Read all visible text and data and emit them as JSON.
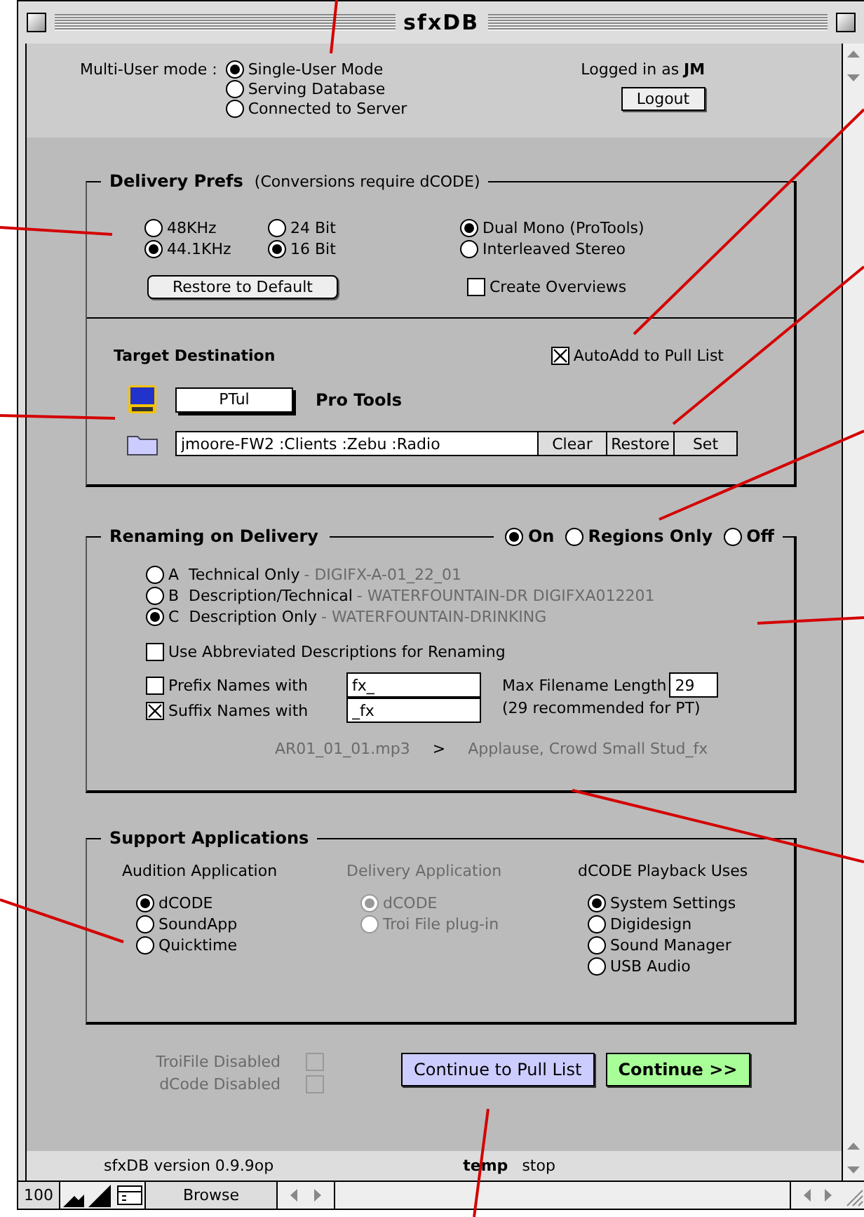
{
  "window": {
    "title": "sfxDB"
  },
  "multi_user": {
    "label": "Multi-User mode :",
    "options": [
      {
        "label": "Single-User Mode",
        "selected": true
      },
      {
        "label": "Serving Database",
        "selected": false
      },
      {
        "label": "Connected to Server",
        "selected": false
      }
    ]
  },
  "login": {
    "text": "Logged in as **JM**",
    "button": "Logout"
  },
  "delivery_prefs": {
    "title": "Delivery Prefs",
    "note": "(Conversions require dCODE)",
    "sample_rates": [
      {
        "label": "48KHz",
        "selected": false
      },
      {
        "label": "44.1KHz",
        "selected": true
      }
    ],
    "bit_depths": [
      {
        "label": "24 Bit",
        "selected": false
      },
      {
        "label": "16 Bit",
        "selected": true
      }
    ],
    "channel_formats": [
      {
        "label": "Dual Mono (ProTools)",
        "selected": true
      },
      {
        "label": "Interleaved Stereo",
        "selected": false
      }
    ],
    "restore_button": "Restore to Default",
    "create_overviews": {
      "label": "Create Overviews",
      "checked": false
    }
  },
  "target_destination": {
    "title": "Target Destination",
    "auto_add": {
      "label": "AutoAdd to Pull List",
      "checked": true
    },
    "app_code": "PTul",
    "app_name": "Pro Tools",
    "path": "jmoore-FW2 :Clients :Zebu :Radio",
    "buttons": [
      "Clear",
      "Restore",
      "Set"
    ]
  },
  "renaming": {
    "title": "Renaming on Delivery",
    "modes": [
      {
        "label": "On",
        "selected": true
      },
      {
        "label": "Regions Only",
        "selected": false
      },
      {
        "label": "Off",
        "selected": false
      }
    ],
    "styles": [
      {
        "key": "A",
        "label": "Technical Only",
        "example": "- DIGIFX-A-01_22_01",
        "selected": false
      },
      {
        "key": "B",
        "label": "Description/Technical",
        "example": "- WATERFOUNTAIN-DR DIGIFXA012201",
        "selected": false
      },
      {
        "key": "C",
        "label": "Description Only",
        "example": "- WATERFOUNTAIN-DRINKING",
        "selected": true
      }
    ],
    "abbreviated": {
      "label": "Use Abbreviated Descriptions for Renaming",
      "checked": false
    },
    "affixes": [
      {
        "label": "Prefix Names with",
        "checked": false,
        "value": "fx_"
      },
      {
        "label": "Suffix Names with",
        "checked": true,
        "value": "_fx"
      }
    ],
    "max_length": {
      "label": "Max Filename Length",
      "value": "29",
      "note": "(29 recommended for PT)"
    },
    "preview": {
      "source": "AR01_01_01.mp3",
      "arrow": ">",
      "result": "Applause, Crowd Small Stud_fx"
    }
  },
  "support": {
    "title": "Support Applications",
    "columns": [
      {
        "title": "Audition Application",
        "disabled": false,
        "options": [
          {
            "label": "dCODE",
            "selected": true
          },
          {
            "label": "SoundApp",
            "selected": false
          },
          {
            "label": "Quicktime",
            "selected": false
          }
        ]
      },
      {
        "title": "Delivery Application",
        "disabled": true,
        "options": [
          {
            "label": "dCODE",
            "selected": true
          },
          {
            "label": "Troi File plug-in",
            "selected": false
          }
        ]
      },
      {
        "title": "dCODE Playback Uses",
        "disabled": false,
        "options": [
          {
            "label": "System Settings",
            "selected": true
          },
          {
            "label": "Digidesign",
            "selected": false
          },
          {
            "label": "Sound Manager",
            "selected": false
          },
          {
            "label": "USB Audio",
            "selected": false
          }
        ]
      }
    ]
  },
  "disabled_flags": [
    {
      "label": "TroiFile Disabled",
      "checked": false,
      "disabled": true
    },
    {
      "label": "dCode Disabled",
      "checked": false,
      "disabled": true
    }
  ],
  "buttons": [
    {
      "label": "Continue to Pull List",
      "kind": "secondary"
    },
    {
      "label": "Continue >>",
      "kind": "primary"
    }
  ],
  "status_bar": {
    "version": "sfxDB version  0.9.9op",
    "layout": "temp",
    "action": "stop"
  },
  "bottom_bar": {
    "zoom": "100",
    "mode": "Browse"
  }
}
